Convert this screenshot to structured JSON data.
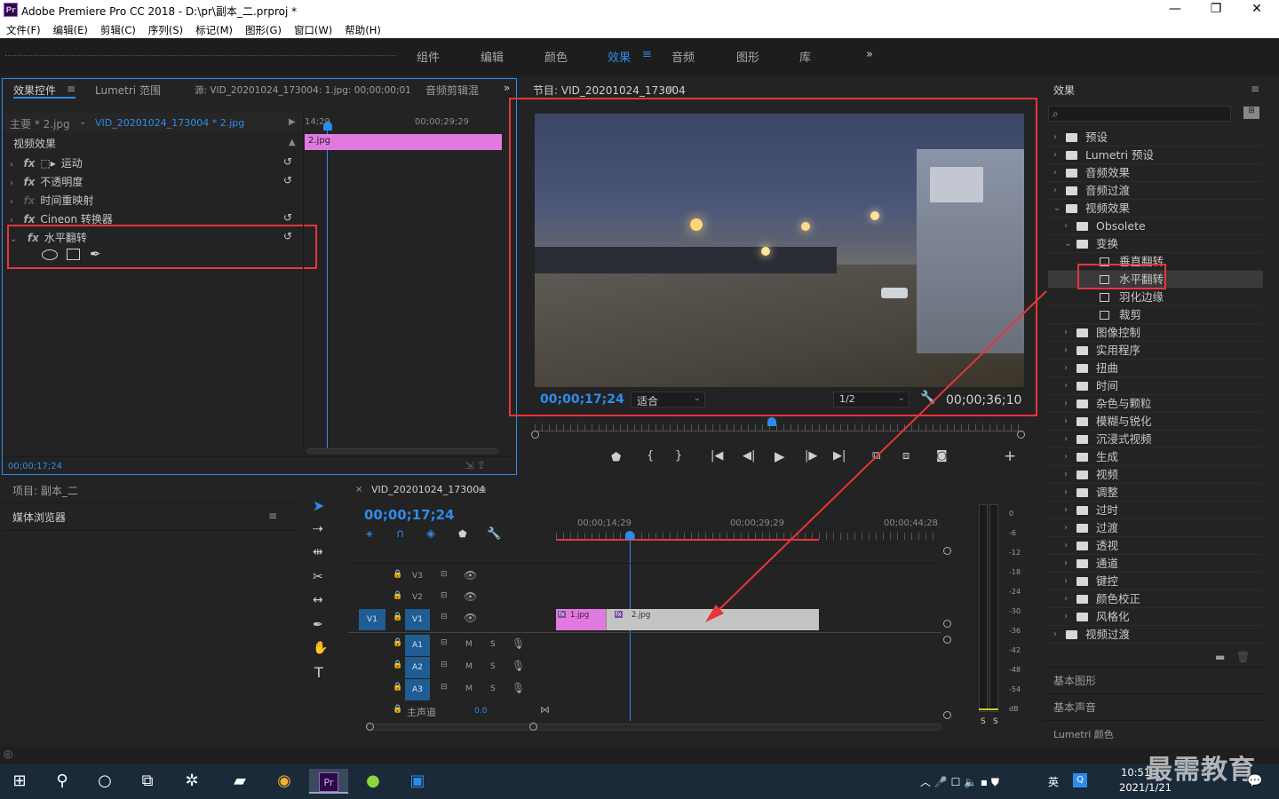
{
  "titlebar": {
    "icon": "Pr",
    "title": "Adobe Premiere Pro CC 2018 - D:\\pr\\副本_二.prproj *",
    "min": "—",
    "max": "❐",
    "close": "✕"
  },
  "menu": [
    "文件(F)",
    "编辑(E)",
    "剪辑(C)",
    "序列(S)",
    "标记(M)",
    "图形(G)",
    "窗口(W)",
    "帮助(H)"
  ],
  "workspaces": {
    "items": [
      "组件",
      "编辑",
      "颜色",
      "效果",
      "音频",
      "图形",
      "库"
    ],
    "active": "效果",
    "more": "»"
  },
  "effect_controls": {
    "tabs": [
      "效果控件",
      "Lumetri 范围",
      "源: VID_20201024_173004: 1.jpg: 00;00;00;01",
      "音频剪辑混"
    ],
    "master": "主要 * 2.jpg",
    "clip": "VID_20201024_173004 * 2.jpg",
    "tl_start": "14;29",
    "tl_end": "00;00;29;29",
    "clip_label": "2.jpg",
    "section": "视频效果",
    "effects": [
      "运动",
      "不透明度",
      "时间重映射",
      "Cineon 转换器",
      "水平翻转"
    ],
    "fx": "fx",
    "timecode": "00;00;17;24"
  },
  "program": {
    "title": "节目: VID_20201024_173004",
    "timecode": "00;00;17;24",
    "fit": "适合",
    "res": "1/2",
    "duration": "00;00;36;10"
  },
  "project": {
    "title": "项目: 副本_二",
    "media": "媒体浏览器"
  },
  "timeline": {
    "seq": "VID_20201024_173004",
    "timecode": "00;00;17;24",
    "ruler": [
      "00;00;14;29",
      "00;00;29;29",
      "00;00;44;28"
    ],
    "tracks_v": [
      "V3",
      "V2",
      "V1"
    ],
    "tracks_a": [
      "A1",
      "A2",
      "A3"
    ],
    "v1_src": "V1",
    "master": "主声道",
    "master_val": "0.0",
    "m": "M",
    "s": "S",
    "clips": [
      {
        "label": "1.jpg"
      },
      {
        "label": "2.jpg"
      }
    ]
  },
  "meter": {
    "ticks": [
      "0",
      "-6",
      "-12",
      "-18",
      "-24",
      "-30",
      "-36",
      "-42",
      "-48",
      "-54",
      "dB"
    ],
    "solo": [
      "S",
      "S"
    ]
  },
  "effects_panel": {
    "title": "效果",
    "items": [
      {
        "label": "预设",
        "lvl": 0,
        "exp": false,
        "ico": "folder"
      },
      {
        "label": "Lumetri 预设",
        "lvl": 0,
        "exp": false,
        "ico": "folder"
      },
      {
        "label": "音频效果",
        "lvl": 0,
        "exp": false,
        "ico": "folder"
      },
      {
        "label": "音频过渡",
        "lvl": 0,
        "exp": false,
        "ico": "folder"
      },
      {
        "label": "视频效果",
        "lvl": 0,
        "exp": true,
        "ico": "folder"
      },
      {
        "label": "Obsolete",
        "lvl": 1,
        "exp": false,
        "ico": "folder"
      },
      {
        "label": "变换",
        "lvl": 1,
        "exp": true,
        "ico": "folder"
      },
      {
        "label": "垂直翻转",
        "lvl": 2,
        "exp": null,
        "ico": "fx"
      },
      {
        "label": "水平翻转",
        "lvl": 2,
        "exp": null,
        "ico": "fx"
      },
      {
        "label": "羽化边缘",
        "lvl": 2,
        "exp": null,
        "ico": "fx"
      },
      {
        "label": "裁剪",
        "lvl": 2,
        "exp": null,
        "ico": "fx"
      },
      {
        "label": "图像控制",
        "lvl": 1,
        "exp": false,
        "ico": "folder"
      },
      {
        "label": "实用程序",
        "lvl": 1,
        "exp": false,
        "ico": "folder"
      },
      {
        "label": "扭曲",
        "lvl": 1,
        "exp": false,
        "ico": "folder"
      },
      {
        "label": "时间",
        "lvl": 1,
        "exp": false,
        "ico": "folder"
      },
      {
        "label": "杂色与颗粒",
        "lvl": 1,
        "exp": false,
        "ico": "folder"
      },
      {
        "label": "模糊与锐化",
        "lvl": 1,
        "exp": false,
        "ico": "folder"
      },
      {
        "label": "沉浸式视频",
        "lvl": 1,
        "exp": false,
        "ico": "folder"
      },
      {
        "label": "生成",
        "lvl": 1,
        "exp": false,
        "ico": "folder"
      },
      {
        "label": "视频",
        "lvl": 1,
        "exp": false,
        "ico": "folder"
      },
      {
        "label": "调整",
        "lvl": 1,
        "exp": false,
        "ico": "folder"
      },
      {
        "label": "过时",
        "lvl": 1,
        "exp": false,
        "ico": "folder"
      },
      {
        "label": "过渡",
        "lvl": 1,
        "exp": false,
        "ico": "folder"
      },
      {
        "label": "透视",
        "lvl": 1,
        "exp": false,
        "ico": "folder"
      },
      {
        "label": "通道",
        "lvl": 1,
        "exp": false,
        "ico": "folder"
      },
      {
        "label": "键控",
        "lvl": 1,
        "exp": false,
        "ico": "folder"
      },
      {
        "label": "颜色校正",
        "lvl": 1,
        "exp": false,
        "ico": "folder"
      },
      {
        "label": "风格化",
        "lvl": 1,
        "exp": false,
        "ico": "folder"
      },
      {
        "label": "视频过渡",
        "lvl": 0,
        "exp": false,
        "ico": "folder"
      }
    ],
    "selected": "水平翻转",
    "sections": [
      "基本图形",
      "基本声音",
      "Lumetri 颜色"
    ]
  },
  "taskbar": {
    "time": "10:51",
    "date": "2021/1/21",
    "lang": "英",
    "watermark": "最需教育"
  },
  "colors": {
    "accent": "#2d8ceb",
    "highlight": "#e8353a",
    "clip": "#e07ae0"
  }
}
